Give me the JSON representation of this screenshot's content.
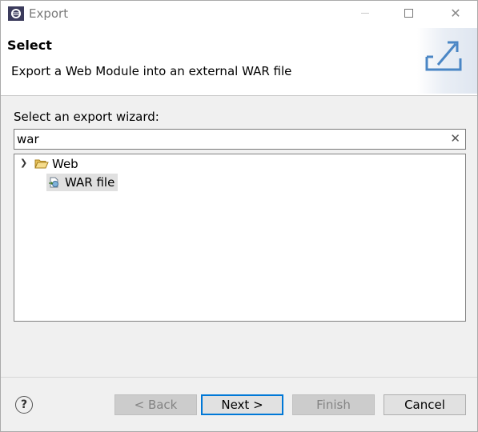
{
  "window": {
    "title": "Export"
  },
  "header": {
    "title": "Select",
    "description": "Export a Web Module into an external WAR file",
    "banner_icon": "export-icon"
  },
  "wizard": {
    "prompt": "Select an export wizard:",
    "filter_value": "war",
    "tree": [
      {
        "label": "Web",
        "expanded": true,
        "icon": "folder-open-icon",
        "children": [
          {
            "label": "WAR file",
            "icon": "war-file-icon",
            "selected": true
          }
        ]
      }
    ]
  },
  "footer": {
    "back_label": "< Back",
    "next_label": "Next >",
    "finish_label": "Finish",
    "cancel_label": "Cancel",
    "help_glyph": "?"
  },
  "colors": {
    "accent": "#0078d7",
    "selection": "#e0e0e0"
  }
}
